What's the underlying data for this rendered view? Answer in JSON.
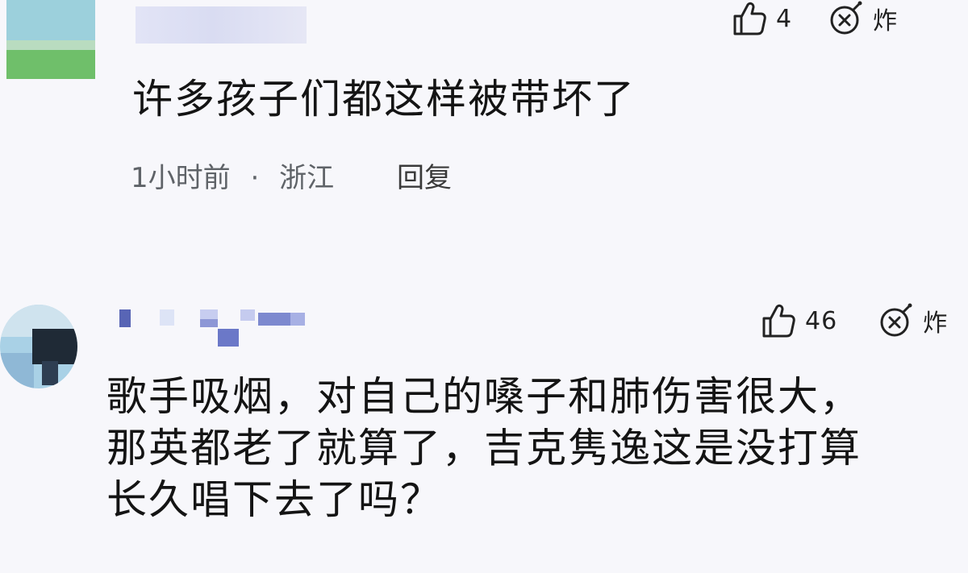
{
  "comments": [
    {
      "like_count": "4",
      "bomb_label": "炸",
      "text": "许多孩子们都这样被带坏了",
      "time": "1小时前",
      "separator": "·",
      "location": "浙江",
      "reply_label": "回复"
    },
    {
      "like_count": "46",
      "bomb_label": "炸",
      "text_lines": [
        "歌手吸烟，对自己的嗓子和肺伤害很大，",
        "那英都老了就算了，吉克隽逸这是没打算",
        "长久唱下去了吗？"
      ]
    }
  ],
  "icons": {
    "like": "thumbs-up-icon",
    "bomb": "bomb-icon"
  },
  "colors": {
    "background": "#f7f7fb",
    "text": "#141414",
    "meta": "#5f6368"
  }
}
